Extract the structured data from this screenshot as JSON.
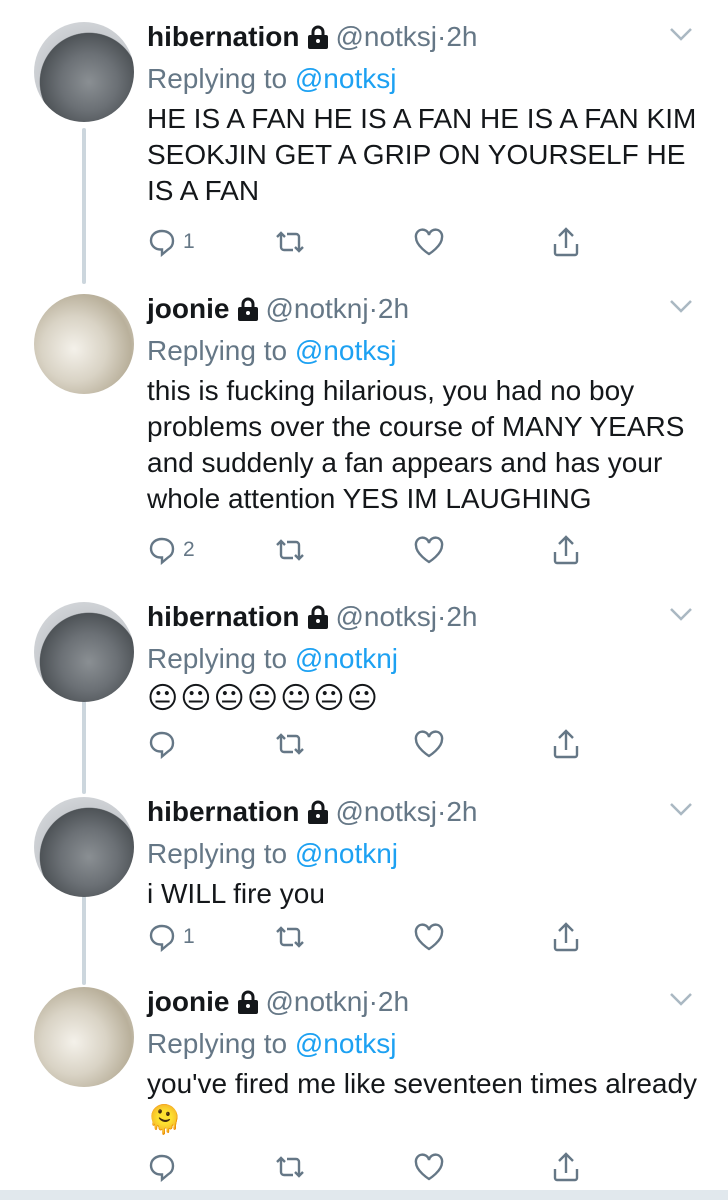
{
  "tweets": [
    {
      "name": "hibernation",
      "handle": "@notksj",
      "time": "2h",
      "replying_prefix": "Replying to",
      "replying_to": "@notksj",
      "text": "HE IS A FAN HE IS A FAN HE IS A FAN KIM SEOKJIN GET A GRIP ON YOURSELF HE IS A FAN",
      "reply_count": "1",
      "avatar": "totoro"
    },
    {
      "name": "joonie",
      "handle": "@notknj",
      "time": "2h",
      "replying_prefix": "Replying to",
      "replying_to": "@notksj",
      "text": "this is fucking hilarious, you had no boy problems over the course of MANY YEARS and suddenly a fan appears and has your whole attention YES IM LAUGHING",
      "reply_count": "2",
      "avatar": "book"
    },
    {
      "name": "hibernation",
      "handle": "@notksj",
      "time": "2h",
      "replying_prefix": "Replying to",
      "replying_to": "@notknj",
      "emoji": "😐😐😐😐😐😐😐",
      "reply_count": "",
      "avatar": "totoro"
    },
    {
      "name": "hibernation",
      "handle": "@notksj",
      "time": "2h",
      "replying_prefix": "Replying to",
      "replying_to": "@notknj",
      "text": "i WILL fire you",
      "reply_count": "1",
      "avatar": "totoro"
    },
    {
      "name": "joonie",
      "handle": "@notknj",
      "time": "2h",
      "replying_prefix": "Replying to",
      "replying_to": "@notksj",
      "text": "you've fired me like seventeen times already",
      "trailing_emoji": "🫠",
      "reply_count": "",
      "avatar": "book"
    }
  ],
  "separator": "·",
  "icons": {
    "lock": "lock-icon",
    "reply": "reply-icon",
    "retweet": "retweet-icon",
    "like": "heart-icon",
    "share": "share-icon",
    "menu": "chevron-down-icon"
  },
  "colors": {
    "accent": "#1da1f2",
    "muted": "#657786",
    "text": "#14171a",
    "thread": "#ccd6dd"
  }
}
